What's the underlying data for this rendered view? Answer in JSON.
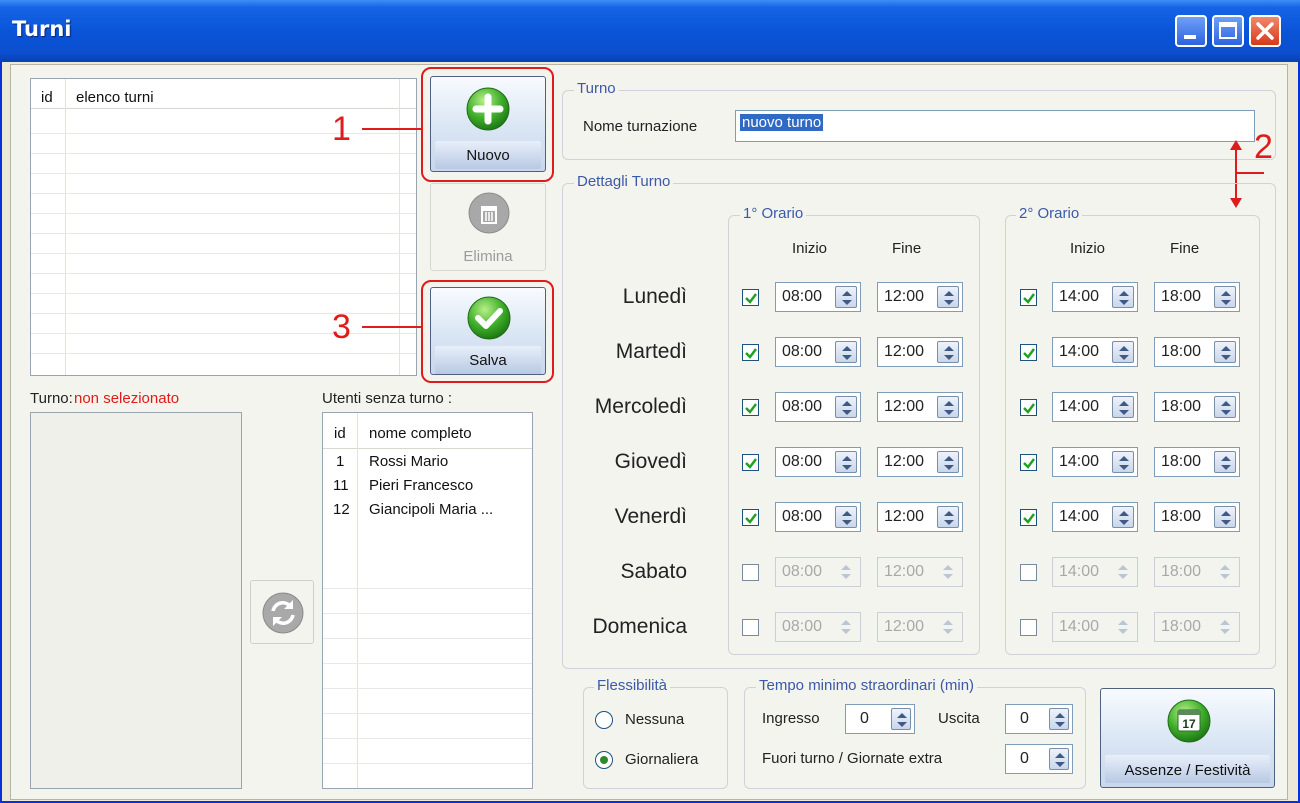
{
  "window": {
    "title": "Turni"
  },
  "list_turni": {
    "col_id": "id",
    "col_name": "elenco turni"
  },
  "buttons": {
    "nuovo": "Nuovo",
    "elimina": "Elimina",
    "salva": "Salva",
    "assenze": "Assenze / Festività"
  },
  "annotations": {
    "one": "1",
    "two": "2",
    "three": "3"
  },
  "turno_status": {
    "label": "Turno:",
    "value": "non selezionato"
  },
  "users": {
    "title": "Utenti senza turno :",
    "col_id": "id",
    "col_name": "nome completo",
    "rows": [
      {
        "id": "1",
        "name": "Rossi Mario"
      },
      {
        "id": "11",
        "name": "Pieri Francesco"
      },
      {
        "id": "12",
        "name": "Giancipoli Maria ..."
      }
    ]
  },
  "turno_group": {
    "title": "Turno",
    "name_label": "Nome turnazione",
    "name_value": "nuovo turno"
  },
  "dettagli": {
    "title": "Dettagli Turno",
    "orario1_title": "1° Orario",
    "orario2_title": "2° Orario",
    "inizio": "Inizio",
    "fine": "Fine",
    "days": [
      {
        "name": "Lunedì",
        "enabled": true,
        "o1_start": "08:00",
        "o1_end": "12:00",
        "o2_start": "14:00",
        "o2_end": "18:00"
      },
      {
        "name": "Martedì",
        "enabled": true,
        "o1_start": "08:00",
        "o1_end": "12:00",
        "o2_start": "14:00",
        "o2_end": "18:00"
      },
      {
        "name": "Mercoledì",
        "enabled": true,
        "o1_start": "08:00",
        "o1_end": "12:00",
        "o2_start": "14:00",
        "o2_end": "18:00"
      },
      {
        "name": "Giovedì",
        "enabled": true,
        "o1_start": "08:00",
        "o1_end": "12:00",
        "o2_start": "14:00",
        "o2_end": "18:00"
      },
      {
        "name": "Venerdì",
        "enabled": true,
        "o1_start": "08:00",
        "o1_end": "12:00",
        "o2_start": "14:00",
        "o2_end": "18:00"
      },
      {
        "name": "Sabato",
        "enabled": false,
        "o1_start": "08:00",
        "o1_end": "12:00",
        "o2_start": "14:00",
        "o2_end": "18:00"
      },
      {
        "name": "Domenica",
        "enabled": false,
        "o1_start": "08:00",
        "o1_end": "12:00",
        "o2_start": "14:00",
        "o2_end": "18:00"
      }
    ]
  },
  "flessibilita": {
    "title": "Flessibilità",
    "opt_nessuna": "Nessuna",
    "opt_giornaliera": "Giornaliera",
    "selected": "Giornaliera"
  },
  "straordinari": {
    "title": "Tempo minimo straordinari  (min)",
    "ingresso_label": "Ingresso",
    "ingresso_value": "0",
    "uscita_label": "Uscita",
    "uscita_value": "0",
    "fuori_label": "Fuori turno  /  Giornate extra",
    "fuori_value": "0"
  },
  "calendar_icon_text": "17",
  "colors": {
    "title_bar": "#0a54d8",
    "annotation_red": "#e01b1b",
    "group_title_blue": "#3a59a8",
    "status_red": "#e01b1b"
  }
}
